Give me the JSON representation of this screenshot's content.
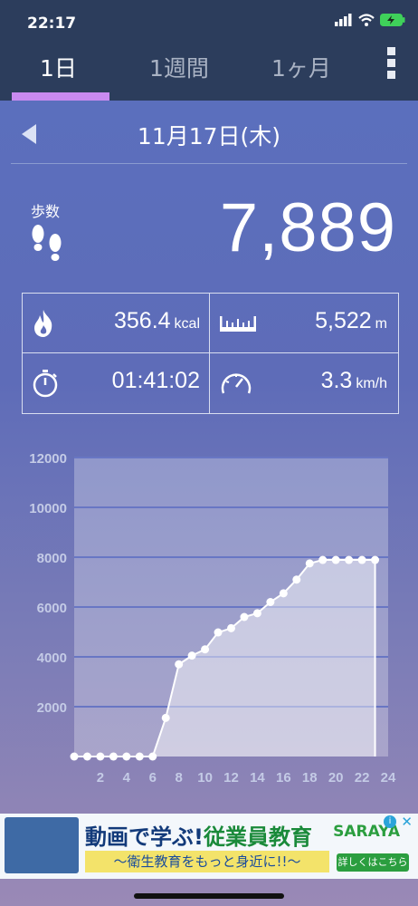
{
  "status": {
    "time": "22:17"
  },
  "tabs": [
    {
      "label": "1日",
      "active": true
    },
    {
      "label": "1週間",
      "active": false
    },
    {
      "label": "1ヶ月",
      "active": false
    }
  ],
  "date": "11月17日(木)",
  "steps": {
    "label": "歩数",
    "value": "7,889"
  },
  "stats": {
    "calories": {
      "value": "356.4",
      "unit": "kcal"
    },
    "distance": {
      "value": "5,522",
      "unit": "m"
    },
    "time": {
      "value": "01:41:02"
    },
    "speed": {
      "value": "3.3",
      "unit": "km/h"
    }
  },
  "chart_data": {
    "type": "area",
    "title": "",
    "xlabel": "",
    "ylabel": "",
    "x": [
      0,
      1,
      2,
      3,
      4,
      5,
      6,
      7,
      8,
      9,
      10,
      11,
      12,
      13,
      14,
      15,
      16,
      17,
      18,
      19,
      20,
      21,
      22,
      23
    ],
    "values": [
      0,
      0,
      0,
      0,
      0,
      0,
      0,
      1550,
      3700,
      4050,
      4300,
      4980,
      5150,
      5600,
      5750,
      6200,
      6550,
      7100,
      7750,
      7889,
      7889,
      7889,
      7889,
      7889
    ],
    "xticks": [
      "2",
      "4",
      "6",
      "8",
      "10",
      "12",
      "14",
      "16",
      "18",
      "20",
      "22",
      "24"
    ],
    "yticks": [
      "2000",
      "4000",
      "6000",
      "8000",
      "10000",
      "12000"
    ],
    "xlim": [
      0,
      24
    ],
    "ylim": [
      0,
      12000
    ],
    "grid": true
  },
  "ad": {
    "title_a": "動画で学ぶ!",
    "title_b": "従業員教育",
    "subtitle": "〜衛生教育をもっと身近に!!〜",
    "brand": "SARAYA",
    "cta": "詳しくはこちら",
    "info": "i",
    "close": "✕"
  },
  "colors": {
    "header": "#2c3d5c",
    "tab_accent": "#c98af0",
    "chart_fill": "#b9bddf"
  }
}
